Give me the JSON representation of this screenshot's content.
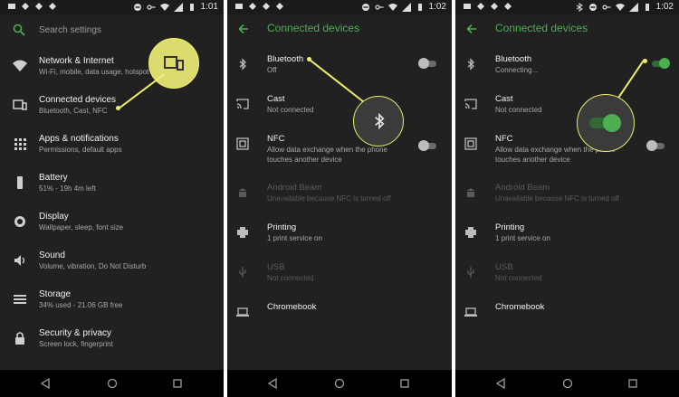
{
  "colors": {
    "accent": "#4caf50",
    "highlight": "#f2f266"
  },
  "panel1": {
    "time": "1:01",
    "search_placeholder": "Search settings",
    "items": [
      {
        "icon": "wifi-icon",
        "title": "Network & Internet",
        "sub": "Wi-Fi, mobile, data usage, hotspot"
      },
      {
        "icon": "connected-devices-icon",
        "title": "Connected devices",
        "sub": "Bluetooth, Cast, NFC"
      },
      {
        "icon": "apps-icon",
        "title": "Apps & notifications",
        "sub": "Permissions, default apps"
      },
      {
        "icon": "battery-icon",
        "title": "Battery",
        "sub": "51% - 19h 4m left"
      },
      {
        "icon": "display-icon",
        "title": "Display",
        "sub": "Wallpaper, sleep, font size"
      },
      {
        "icon": "sound-icon",
        "title": "Sound",
        "sub": "Volume, vibration, Do Not Disturb"
      },
      {
        "icon": "storage-icon",
        "title": "Storage",
        "sub": "34% used - 21.06 GB free"
      },
      {
        "icon": "lock-icon",
        "title": "Security & privacy",
        "sub": "Screen lock, fingerprint"
      }
    ]
  },
  "panel2": {
    "time": "1:02",
    "title": "Connected devices",
    "items": [
      {
        "icon": "bluetooth-icon",
        "title": "Bluetooth",
        "sub": "Off"
      },
      {
        "icon": "cast-icon",
        "title": "Cast",
        "sub": "Not connected"
      },
      {
        "icon": "nfc-icon",
        "title": "NFC",
        "sub": "Allow data exchange when the phone touches another device"
      },
      {
        "icon": "android-beam-icon",
        "title": "Android Beam",
        "sub": "Unavailable because NFC is turned off"
      },
      {
        "icon": "printer-icon",
        "title": "Printing",
        "sub": "1 print service on"
      },
      {
        "icon": "usb-icon",
        "title": "USB",
        "sub": "Not connected"
      },
      {
        "icon": "chromebook-icon",
        "title": "Chromebook",
        "sub": ""
      }
    ]
  },
  "panel3": {
    "time": "1:02",
    "title": "Connected devices",
    "items": [
      {
        "icon": "bluetooth-icon",
        "title": "Bluetooth",
        "sub": "Connecting..."
      },
      {
        "icon": "cast-icon",
        "title": "Cast",
        "sub": "Not connected"
      },
      {
        "icon": "nfc-icon",
        "title": "NFC",
        "sub": "Allow data exchange when the phone touches another device"
      },
      {
        "icon": "android-beam-icon",
        "title": "Android Beam",
        "sub": "Unavailable because NFC is turned off"
      },
      {
        "icon": "printer-icon",
        "title": "Printing",
        "sub": "1 print service on"
      },
      {
        "icon": "usb-icon",
        "title": "USB",
        "sub": "Not connected"
      },
      {
        "icon": "chromebook-icon",
        "title": "Chromebook",
        "sub": ""
      }
    ]
  }
}
